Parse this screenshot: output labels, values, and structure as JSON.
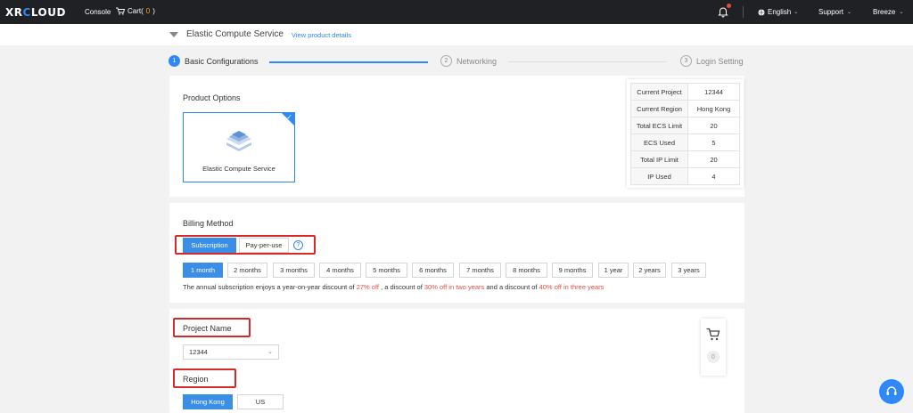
{
  "topbar": {
    "logo_left": "XR",
    "logo_mid": "C",
    "logo_right": "LOUD",
    "console": "Console",
    "cart_label": "Cart(",
    "cart_count": "0",
    "cart_close": ")",
    "language": "English",
    "support": "Support",
    "user": "Breeze"
  },
  "header": {
    "title": "Elastic Compute Service",
    "link": "View product details"
  },
  "steps": [
    {
      "num": "1",
      "label": "Basic Configurations"
    },
    {
      "num": "2",
      "label": "Networking"
    },
    {
      "num": "3",
      "label": "Login Setting"
    }
  ],
  "product": {
    "section_title": "Product Options",
    "item_label": "Elastic Compute Service"
  },
  "info": [
    {
      "key": "Current Project",
      "value": "12344"
    },
    {
      "key": "Current Region",
      "value": "Hong Kong"
    },
    {
      "key": "Total ECS Limit",
      "value": "20"
    },
    {
      "key": "ECS Used",
      "value": "5"
    },
    {
      "key": "Total IP Limit",
      "value": "20"
    },
    {
      "key": "IP Used",
      "value": "4"
    }
  ],
  "billing": {
    "section_title": "Billing Method",
    "methods": [
      "Subscription",
      "Pay-per-use"
    ],
    "help": "?",
    "durations": [
      "1 month",
      "2 months",
      "3 months",
      "4 months",
      "5 months",
      "6 months",
      "7 months",
      "8 months",
      "9 months",
      "1 year",
      "2 years",
      "3 years"
    ],
    "note_prefix": "The annual subscription enjoys a year-on-year discount of ",
    "note_d1": "27% off",
    "note_mid1": " , a discount of ",
    "note_d2": "30% off in two years",
    "note_mid2": " and a discount of ",
    "note_d3": "40% off in three years"
  },
  "project": {
    "section_title": "Project Name",
    "selected": "12344"
  },
  "region": {
    "section_title": "Region",
    "options": [
      "Hong Kong",
      "US"
    ]
  },
  "cart_float": {
    "count": "0"
  },
  "colors": {
    "accent": "#2f88f5",
    "highlight_red": "#d62a2a",
    "discount_red": "#e74c3c"
  }
}
